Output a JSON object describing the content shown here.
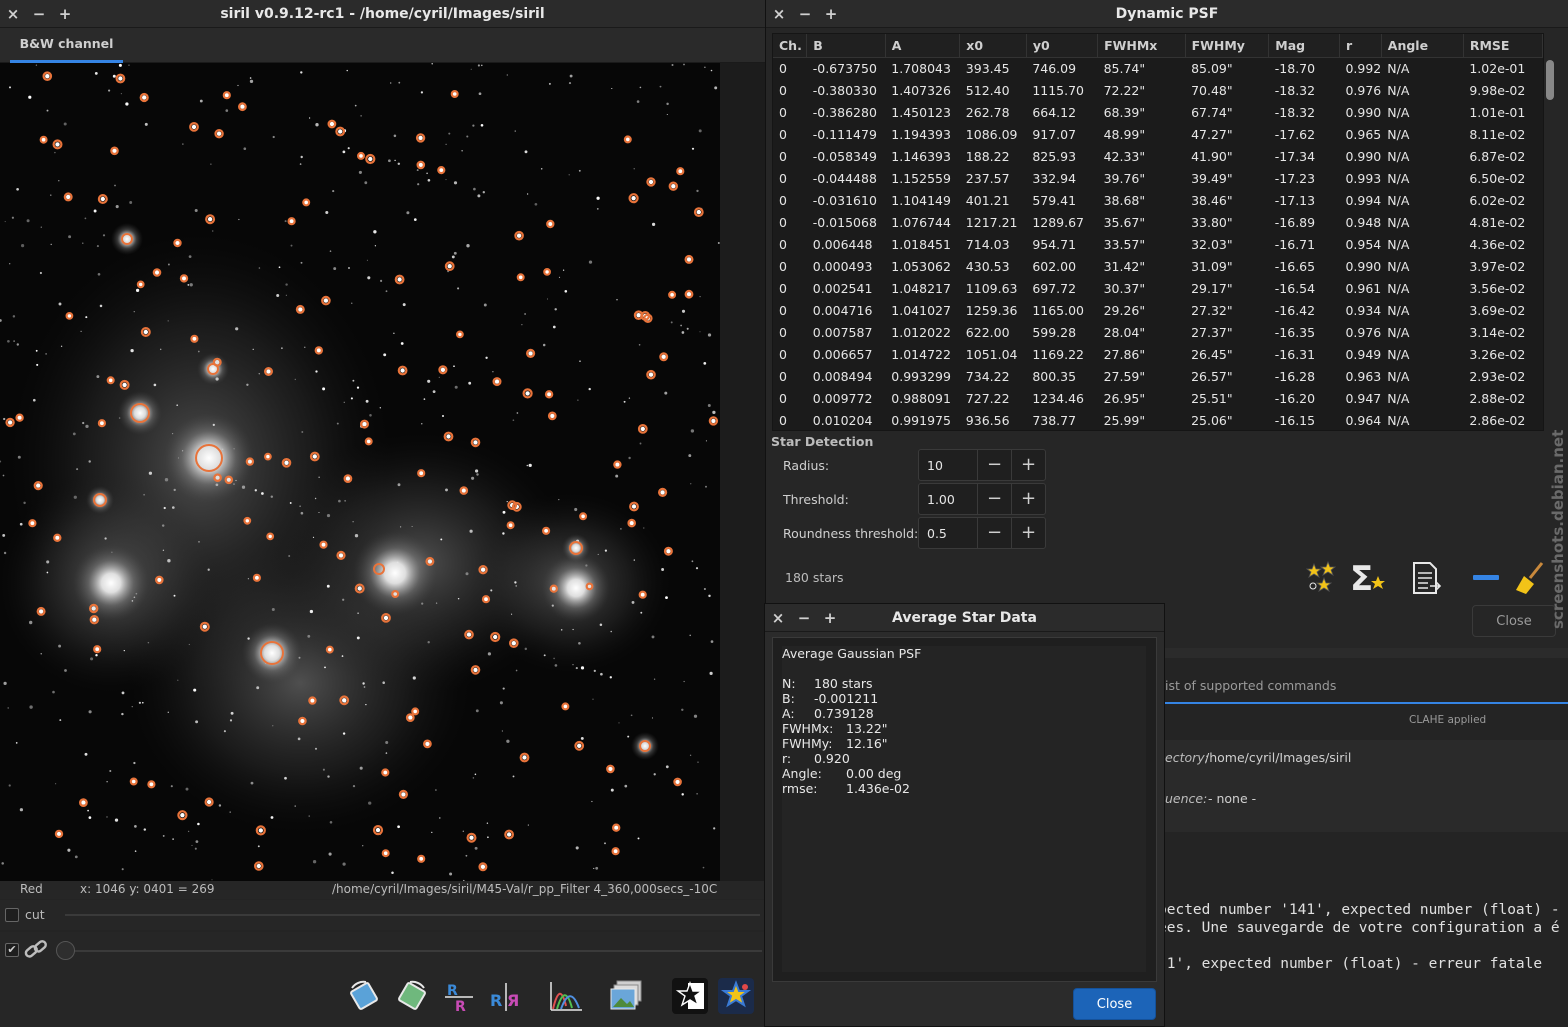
{
  "main_window": {
    "title": "siril v0.9.12-rc1 - /home/cyril/Images/siril",
    "controls": [
      "×",
      "−",
      "+"
    ],
    "tab": "B&W channel",
    "status": {
      "channel": "Red",
      "coords": "x: 1046 y: 0401 = 269",
      "path": "/home/cyril/Images/siril/M45-Val/r_pp_Filter 4_360,000secs_-10C"
    },
    "cut_label": "cut",
    "toolbar_icons": [
      "rotate-left-icon",
      "rotate-right-icon",
      "mirror-x-icon",
      "mirror-y-icon",
      "histogram-icon",
      "image-stack-icon",
      "star-icon",
      "photometry-icon"
    ]
  },
  "psf_window": {
    "title": "Dynamic PSF",
    "controls": [
      "×",
      "−",
      "+"
    ],
    "columns": [
      "Ch.",
      "B",
      "A",
      "x0",
      "y0",
      "FWHMx",
      "FWHMy",
      "Mag",
      "r",
      "Angle",
      "RMSE"
    ],
    "rows": [
      [
        "0",
        "-0.673750",
        "1.708043",
        "393.45",
        "746.09",
        "85.74\"",
        "85.09\"",
        "-18.70",
        "0.992",
        "N/A",
        "1.02e-01"
      ],
      [
        "0",
        "-0.380330",
        "1.407326",
        "512.40",
        "1115.70",
        "72.22\"",
        "70.48\"",
        "-18.32",
        "0.976",
        "N/A",
        "9.98e-02"
      ],
      [
        "0",
        "-0.386280",
        "1.450123",
        "262.78",
        "664.12",
        "68.39\"",
        "67.74\"",
        "-18.32",
        "0.990",
        "N/A",
        "1.01e-01"
      ],
      [
        "0",
        "-0.111479",
        "1.194393",
        "1086.09",
        "917.07",
        "48.99\"",
        "47.27\"",
        "-17.62",
        "0.965",
        "N/A",
        "8.11e-02"
      ],
      [
        "0",
        "-0.058349",
        "1.146393",
        "188.22",
        "825.93",
        "42.33\"",
        "41.90\"",
        "-17.34",
        "0.990",
        "N/A",
        "6.87e-02"
      ],
      [
        "0",
        "-0.044488",
        "1.152559",
        "237.57",
        "332.94",
        "39.76\"",
        "39.49\"",
        "-17.23",
        "0.993",
        "N/A",
        "6.50e-02"
      ],
      [
        "0",
        "-0.031610",
        "1.104149",
        "401.21",
        "579.41",
        "38.68\"",
        "38.46\"",
        "-17.13",
        "0.994",
        "N/A",
        "6.02e-02"
      ],
      [
        "0",
        "-0.015068",
        "1.076744",
        "1217.21",
        "1289.67",
        "35.67\"",
        "33.80\"",
        "-16.89",
        "0.948",
        "N/A",
        "4.81e-02"
      ],
      [
        "0",
        "0.006448",
        "1.018451",
        "714.03",
        "954.71",
        "33.57\"",
        "32.03\"",
        "-16.71",
        "0.954",
        "N/A",
        "4.36e-02"
      ],
      [
        "0",
        "0.000493",
        "1.053062",
        "430.53",
        "602.00",
        "31.42\"",
        "31.09\"",
        "-16.65",
        "0.990",
        "N/A",
        "3.97e-02"
      ],
      [
        "0",
        "0.002541",
        "1.048217",
        "1109.63",
        "697.72",
        "30.37\"",
        "29.17\"",
        "-16.54",
        "0.961",
        "N/A",
        "3.56e-02"
      ],
      [
        "0",
        "0.004716",
        "1.041027",
        "1259.36",
        "1165.00",
        "29.26\"",
        "27.32\"",
        "-16.42",
        "0.934",
        "N/A",
        "3.69e-02"
      ],
      [
        "0",
        "0.007587",
        "1.012022",
        "622.00",
        "599.28",
        "28.04\"",
        "27.37\"",
        "-16.35",
        "0.976",
        "N/A",
        "3.14e-02"
      ],
      [
        "0",
        "0.006657",
        "1.014722",
        "1051.04",
        "1169.22",
        "27.86\"",
        "26.45\"",
        "-16.31",
        "0.949",
        "N/A",
        "3.26e-02"
      ],
      [
        "0",
        "0.008494",
        "0.993299",
        "734.22",
        "800.35",
        "27.59\"",
        "26.57\"",
        "-16.28",
        "0.963",
        "N/A",
        "2.93e-02"
      ],
      [
        "0",
        "0.009772",
        "0.988091",
        "727.22",
        "1234.46",
        "26.95\"",
        "25.51\"",
        "-16.20",
        "0.947",
        "N/A",
        "2.88e-02"
      ],
      [
        "0",
        "0.010204",
        "0.991975",
        "936.56",
        "738.77",
        "25.99\"",
        "25.06\"",
        "-16.15",
        "0.964",
        "N/A",
        "2.86e-02"
      ]
    ],
    "star_detection": {
      "heading": "Star Detection",
      "radius_label": "Radius:",
      "radius_value": "10",
      "threshold_label": "Threshold:",
      "threshold_value": "1.00",
      "roundness_label": "Roundness threshold:",
      "roundness_value": "0.5"
    },
    "star_count": "180 stars",
    "close_label": "Close"
  },
  "avg_window": {
    "title": "Average Star Data",
    "controls": [
      "×",
      "−",
      "+"
    ],
    "heading": "Average Gaussian PSF",
    "lines": [
      {
        "k": "N:",
        "v": "180 stars"
      },
      {
        "k": "B:",
        "v": "-0.001211"
      },
      {
        "k": "A:",
        "v": "0.739128"
      },
      {
        "k": "FWHMx:",
        "v": "13.22\""
      },
      {
        "k": "FWHMy:",
        "v": "12.16\""
      },
      {
        "k": "r:",
        "v": "0.920"
      },
      {
        "k": "Angle:",
        "v": "0.00 deg"
      },
      {
        "k": "rmse:",
        "v": "1.436e-02"
      }
    ],
    "close_label": "Close"
  },
  "console": {
    "commands_hint": "ist of supported commands",
    "clahe": "CLAHE applied",
    "directory_label": "ectory:",
    "directory_value": "/home/cyril/Images/siril",
    "sequence_label": "uence:",
    "sequence_value": "- none -",
    "log_lines": [
      "pected number '141', expected number (float) -",
      "ées. Une sauvegarde de votre configuration a é",
      "",
      "'1', expected number (float) - erreur fatale"
    ]
  },
  "watermark": "screenshots.debian.net",
  "colors": {
    "accent": "#3584e4",
    "star_marker": "#e8733a",
    "close_button": "#1c64b8"
  }
}
